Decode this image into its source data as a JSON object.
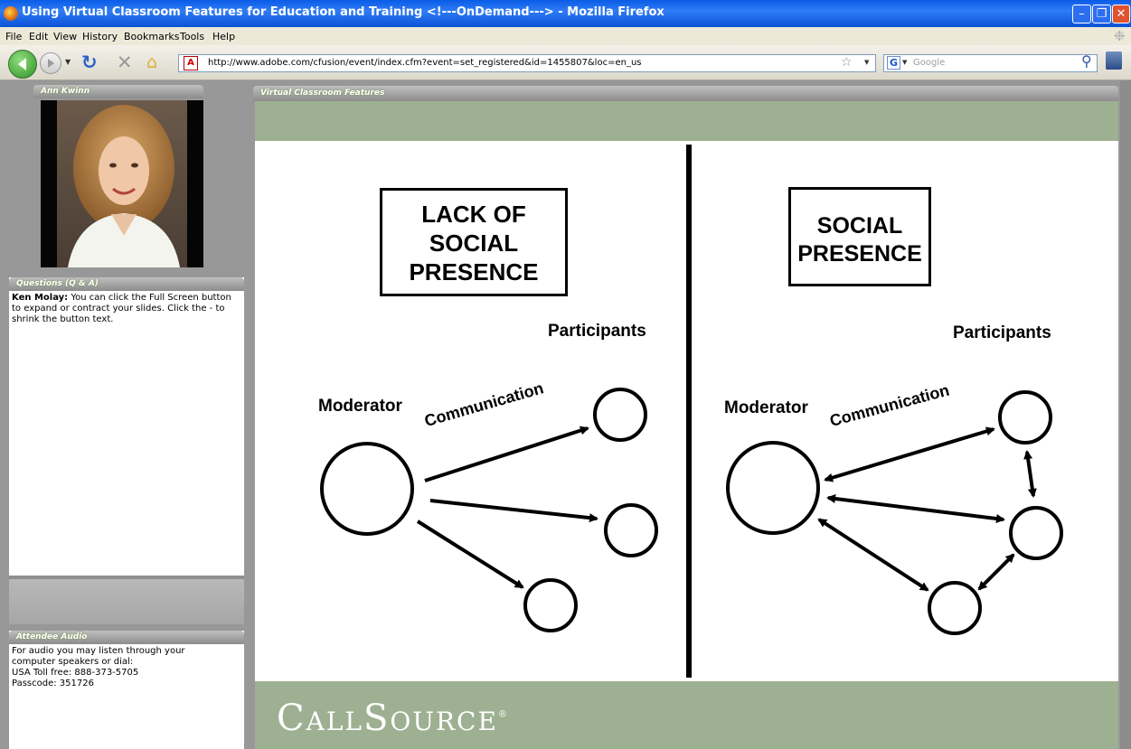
{
  "window": {
    "title": "Using Virtual Classroom Features for Education and Training <!---OnDemand---> - Mozilla Firefox"
  },
  "menu": [
    "File",
    "Edit",
    "View",
    "History",
    "Bookmarks",
    "Tools",
    "Help"
  ],
  "nav": {
    "url": "http://www.adobe.com/cfusion/event/index.cfm?event=set_registered&id=1455807&loc=en_us",
    "search_placeholder": "Google",
    "icons": [
      "back-icon",
      "forward-icon",
      "reload-icon",
      "stop-icon",
      "home-icon",
      "adobe-icon",
      "star-icon",
      "google-icon",
      "search-icon",
      "addon-icon"
    ]
  },
  "presenter": {
    "header": "Ann Kwinn"
  },
  "qa": {
    "header": "Questions (Q & A)",
    "author": "Ken Molay:",
    "message": "You can click the Full Screen button to expand or contract your slides. Click the - to shrink the button text."
  },
  "audio": {
    "header": "Attendee Audio",
    "lines": [
      "For audio you may listen through your",
      "computer speakers or dial:",
      "USA Toll free: 888-373-5705",
      "Passcode: 351726"
    ]
  },
  "slide": {
    "header": "Virtual Classroom Features",
    "left_box": [
      "LACK OF",
      "SOCIAL",
      "PRESENCE"
    ],
    "right_box": [
      "SOCIAL",
      "PRESENCE"
    ],
    "participants": "Participants",
    "moderator": "Moderator",
    "communication": "Communication",
    "logo": "CallSource",
    "logo_mark": "®"
  }
}
